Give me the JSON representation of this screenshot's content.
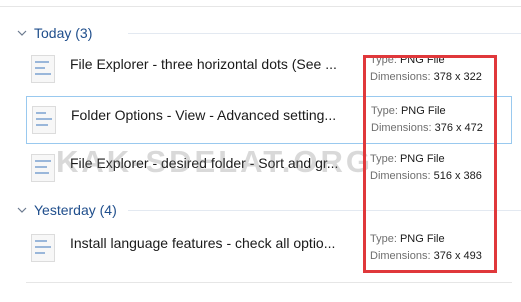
{
  "groups": [
    {
      "label": "Today (3)",
      "items": [
        {
          "name": "File Explorer - three horizontal dots (See ...",
          "type_label": "Type:",
          "type": "PNG File",
          "dimensions_label": "Dimensions:",
          "dimensions": "378 x 322"
        },
        {
          "name": "Folder Options - View - Advanced setting...",
          "type_label": "Type:",
          "type": "PNG File",
          "dimensions_label": "Dimensions:",
          "dimensions": "376 x 472"
        },
        {
          "name": "File Explorer - desired folder - Sort and gr...",
          "type_label": "Type:",
          "type": "PNG File",
          "dimensions_label": "Dimensions:",
          "dimensions": "516 x 386"
        }
      ]
    },
    {
      "label": "Yesterday (4)",
      "items": [
        {
          "name": "Install language features - check all optio...",
          "type_label": "Type:",
          "type": "PNG File",
          "dimensions_label": "Dimensions:",
          "dimensions": "376 x 493"
        }
      ]
    }
  ],
  "watermark": "KAK-SDELAT.ORG",
  "colors": {
    "group_header": "#1f4e8c",
    "highlight_border": "#e0383b",
    "selection_border": "#99c9ef"
  }
}
